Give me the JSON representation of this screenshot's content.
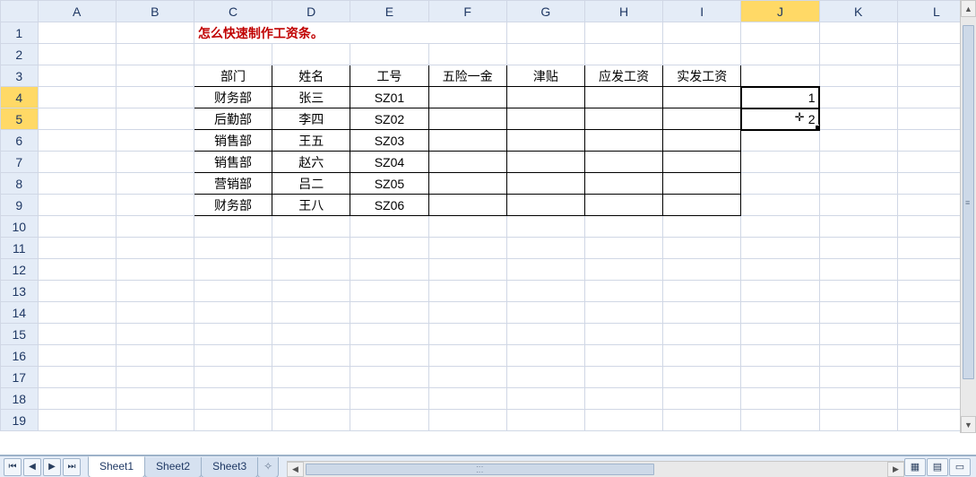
{
  "columns": [
    "A",
    "B",
    "C",
    "D",
    "E",
    "F",
    "G",
    "H",
    "I",
    "J",
    "K",
    "L"
  ],
  "rows": [
    1,
    2,
    3,
    4,
    5,
    6,
    7,
    8,
    9,
    10,
    11,
    12,
    13,
    14,
    15,
    16,
    17,
    18,
    19
  ],
  "title_cell": "怎么快速制作工资条。",
  "headers": [
    "部门",
    "姓名",
    "工号",
    "五险一金",
    "津贴",
    "应发工资",
    "实发工资"
  ],
  "data_rows": [
    {
      "dept": "财务部",
      "name": "张三",
      "id": "SZ01"
    },
    {
      "dept": "后勤部",
      "name": "李四",
      "id": "SZ02"
    },
    {
      "dept": "销售部",
      "name": "王五",
      "id": "SZ03"
    },
    {
      "dept": "销售部",
      "name": "赵六",
      "id": "SZ04"
    },
    {
      "dept": "营销部",
      "name": "吕二",
      "id": "SZ05"
    },
    {
      "dept": "财务部",
      "name": "王八",
      "id": "SZ06"
    }
  ],
  "j_values": {
    "row4": "1",
    "row5": "2"
  },
  "sheets": {
    "s1": "Sheet1",
    "s2": "Sheet2",
    "s3": "Sheet3"
  },
  "selected_rows": [
    4,
    5
  ],
  "selected_col": "J"
}
